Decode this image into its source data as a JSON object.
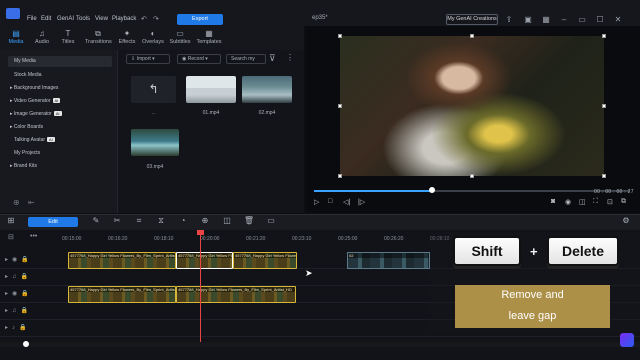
{
  "menu": {
    "items": [
      "File",
      "Edit",
      "GenAI",
      "Tools",
      "View",
      "Playback"
    ],
    "export_label": "Export",
    "project_name": "ep35*",
    "genai_creations": "My GenAI Creations"
  },
  "tabs": [
    {
      "label": "Media",
      "icon": "media-icon",
      "active": true
    },
    {
      "label": "Audio",
      "icon": "audio-icon"
    },
    {
      "label": "Titles",
      "icon": "titles-icon"
    },
    {
      "label": "Transitions",
      "icon": "transitions-icon"
    },
    {
      "label": "Effects",
      "icon": "effects-icon"
    },
    {
      "label": "Overlays",
      "icon": "overlays-icon"
    },
    {
      "label": "Subtitles",
      "icon": "subtitles-icon"
    },
    {
      "label": "Templates",
      "icon": "templates-icon"
    }
  ],
  "sidebar": {
    "items": [
      {
        "label": "My Media",
        "active": true
      },
      {
        "label": "Stock Media"
      },
      {
        "label": "Background Images",
        "expand": true
      },
      {
        "label": "Video Generator",
        "expand": true,
        "badge": "AI"
      },
      {
        "label": "Image Generator",
        "expand": true,
        "badge": "AI"
      },
      {
        "label": "Color Boards",
        "expand": true
      },
      {
        "label": "Talking Avatar",
        "badge": "AI"
      },
      {
        "label": "My Projects"
      },
      {
        "label": "Brand Kits",
        "expand": true
      }
    ]
  },
  "media_panel": {
    "import_label": "Import",
    "record_label": "Record",
    "search_placeholder": "Search my",
    "items": [
      {
        "label": ".."
      },
      {
        "label": "01.mp4"
      },
      {
        "label": "02.mp4"
      },
      {
        "label": "03.mp4"
      }
    ]
  },
  "player": {
    "timecode": "00 : 00 : 00 : 27",
    "progress_fraction": 0.37
  },
  "edit_toolbar": {
    "edit_label": "Edit"
  },
  "timeline": {
    "ruler": [
      "00:15:00",
      "00:16:20",
      "00:18:10",
      "00:20:00",
      "00:21:20",
      "00:23:10",
      "00:25:00",
      "00:26:20",
      "00:28:10"
    ],
    "clip_name": "4577768_Happy Girl Yellow Flowers_By_Film_Sprint_Artlist_HD",
    "gap_clip_name": "02"
  },
  "overlay": {
    "key1": "Shift",
    "key2": "Delete",
    "plus": "+",
    "caption_line1": "Remove and",
    "caption_line2": "leave gap"
  },
  "colors": {
    "accent": "#1f7ae8",
    "clip_border": "#d7b63c",
    "playhead": "#e94545",
    "caption_bg": "#ad9048"
  }
}
